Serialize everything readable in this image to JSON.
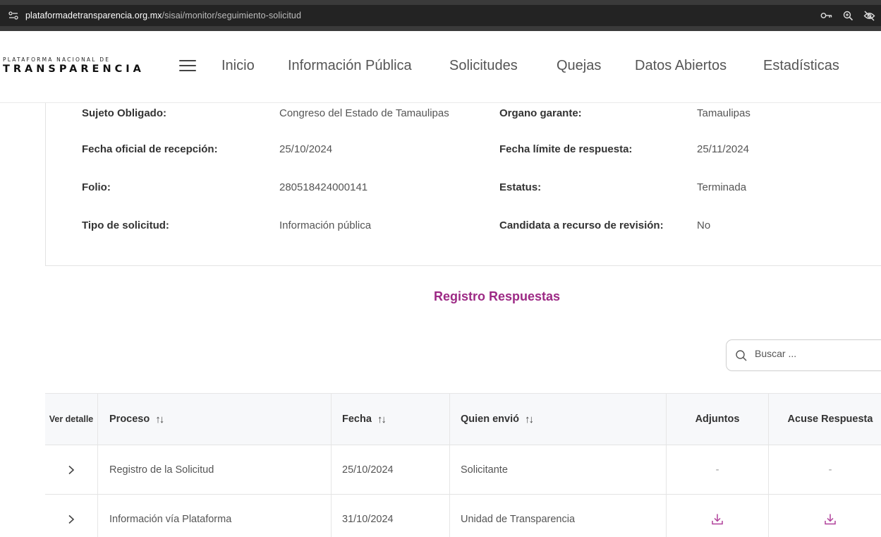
{
  "browser": {
    "url_host": "plataformadetransparencia.org.mx",
    "url_path": "/sisai/monitor/seguimiento-solicitud"
  },
  "brand": {
    "logo_top": "PLATAFORMA NACIONAL DE",
    "logo_bottom": "TRANSPARENCIA",
    "accent_color": "#9d2a85"
  },
  "nav": {
    "items": [
      "Inicio",
      "Información Pública",
      "Solicitudes",
      "Quejas",
      "Datos Abiertos",
      "Estadísticas"
    ]
  },
  "details": {
    "sujeto_label": "Sujeto Obligado:",
    "sujeto_value": "Congreso del Estado de Tamaulipas",
    "organo_label": "Organo garante:",
    "organo_value": "Tamaulipas",
    "recepcion_label": "Fecha oficial de recepción:",
    "recepcion_value": "25/10/2024",
    "limite_label": "Fecha límite de respuesta:",
    "limite_value": "25/11/2024",
    "folio_label": "Folio:",
    "folio_value": "280518424000141",
    "estatus_label": "Estatus:",
    "estatus_value": "Terminada",
    "tipo_label": "Tipo de solicitud:",
    "tipo_value": "Información pública",
    "candidata_label": "Candidata a recurso de revisión:",
    "candidata_value": "No"
  },
  "registro": {
    "title": "Registro Respuestas",
    "search_placeholder": "Buscar ...",
    "columns": {
      "ver": "Ver detalle",
      "proceso": "Proceso",
      "fecha": "Fecha",
      "quien": "Quien envió",
      "adjuntos": "Adjuntos",
      "acuse": "Acuse Respuesta"
    },
    "sort_glyph": "↑↓",
    "rows": [
      {
        "proceso": "Registro de la Solicitud",
        "fecha": "25/10/2024",
        "quien": "Solicitante",
        "adjuntos": "-",
        "acuse": "-"
      },
      {
        "proceso": "Información vía Plataforma",
        "fecha": "31/10/2024",
        "quien": "Unidad de Transparencia",
        "adjuntos_icon": "download-icon",
        "acuse_icon": "download-icon"
      }
    ]
  }
}
